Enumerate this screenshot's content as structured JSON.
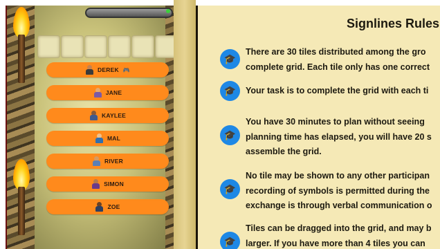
{
  "players": [
    {
      "name": "DEREK",
      "icon": "gamepad-icon"
    },
    {
      "name": "JANE",
      "icon": ""
    },
    {
      "name": "KAYLEE",
      "icon": ""
    },
    {
      "name": "MAL",
      "icon": ""
    },
    {
      "name": "RIVER",
      "icon": ""
    },
    {
      "name": "SIMON",
      "icon": ""
    },
    {
      "name": "ZOE",
      "icon": ""
    }
  ],
  "rules": {
    "title": "Signlines Rules",
    "items": [
      {
        "line1": "There are 30 tiles distributed among the gro",
        "line2": "complete grid. Each tile only has one correct"
      },
      {
        "line1": "Your task is to complete the grid with each ti",
        "line2": ""
      },
      {
        "line1": "You have 30 minutes to plan without seeing",
        "line2": "planning time has elapsed, you will have 20 s",
        "line3": "assemble the grid."
      },
      {
        "line1": "No tile may be shown to any other participan",
        "line2": "recording of symbols is permitted during the",
        "line3": "exchange is through verbal communication o"
      },
      {
        "line1": "Tiles can be dragged into the grid, and may b",
        "line2": "larger. If you have more than 4 tiles you can"
      }
    ]
  },
  "colors": {
    "player_button": "#ff8a1c",
    "rule_icon": "#1e88e5",
    "rules_bg": "#f5e9b6"
  }
}
